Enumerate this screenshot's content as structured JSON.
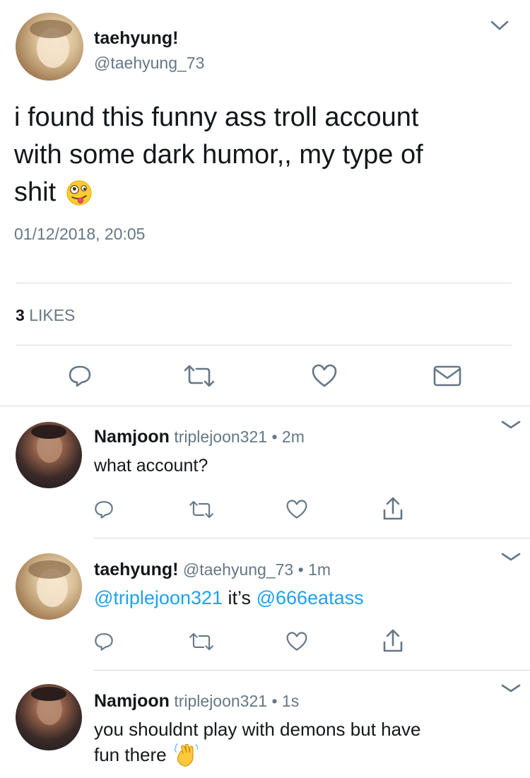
{
  "main_tweet": {
    "display_name": "taehyung!",
    "handle": "@taehyung_73",
    "text_line1": "i found this funny ass troll account",
    "text_line2": "with some dark humor,, my type of",
    "text_line3": "shit",
    "emoji": "zany-face-icon",
    "timestamp": "01/12/2018, 20:05",
    "likes_count": "3",
    "likes_label": "LIKES"
  },
  "replies": [
    {
      "display_name": "Namjoon",
      "handle": "triplejoon321",
      "separator": "•",
      "time": "2m",
      "text": "what account?"
    },
    {
      "display_name": "taehyung!",
      "handle": "@taehyung_73",
      "separator": "•",
      "time": "1m",
      "mention": "@triplejoon321",
      "text_mid": "it’s",
      "mention2": "@666eatass"
    },
    {
      "display_name": "Namjoon",
      "handle": "triplejoon321",
      "separator": "•",
      "time": "1s",
      "text_line1": "you shouldnt play with demons but have",
      "text_line2": "fun there",
      "emoji": "waving-hand-icon"
    }
  ],
  "colors": {
    "link": "#1da1f2",
    "muted": "#657786",
    "divider": "#d5dbe0"
  }
}
